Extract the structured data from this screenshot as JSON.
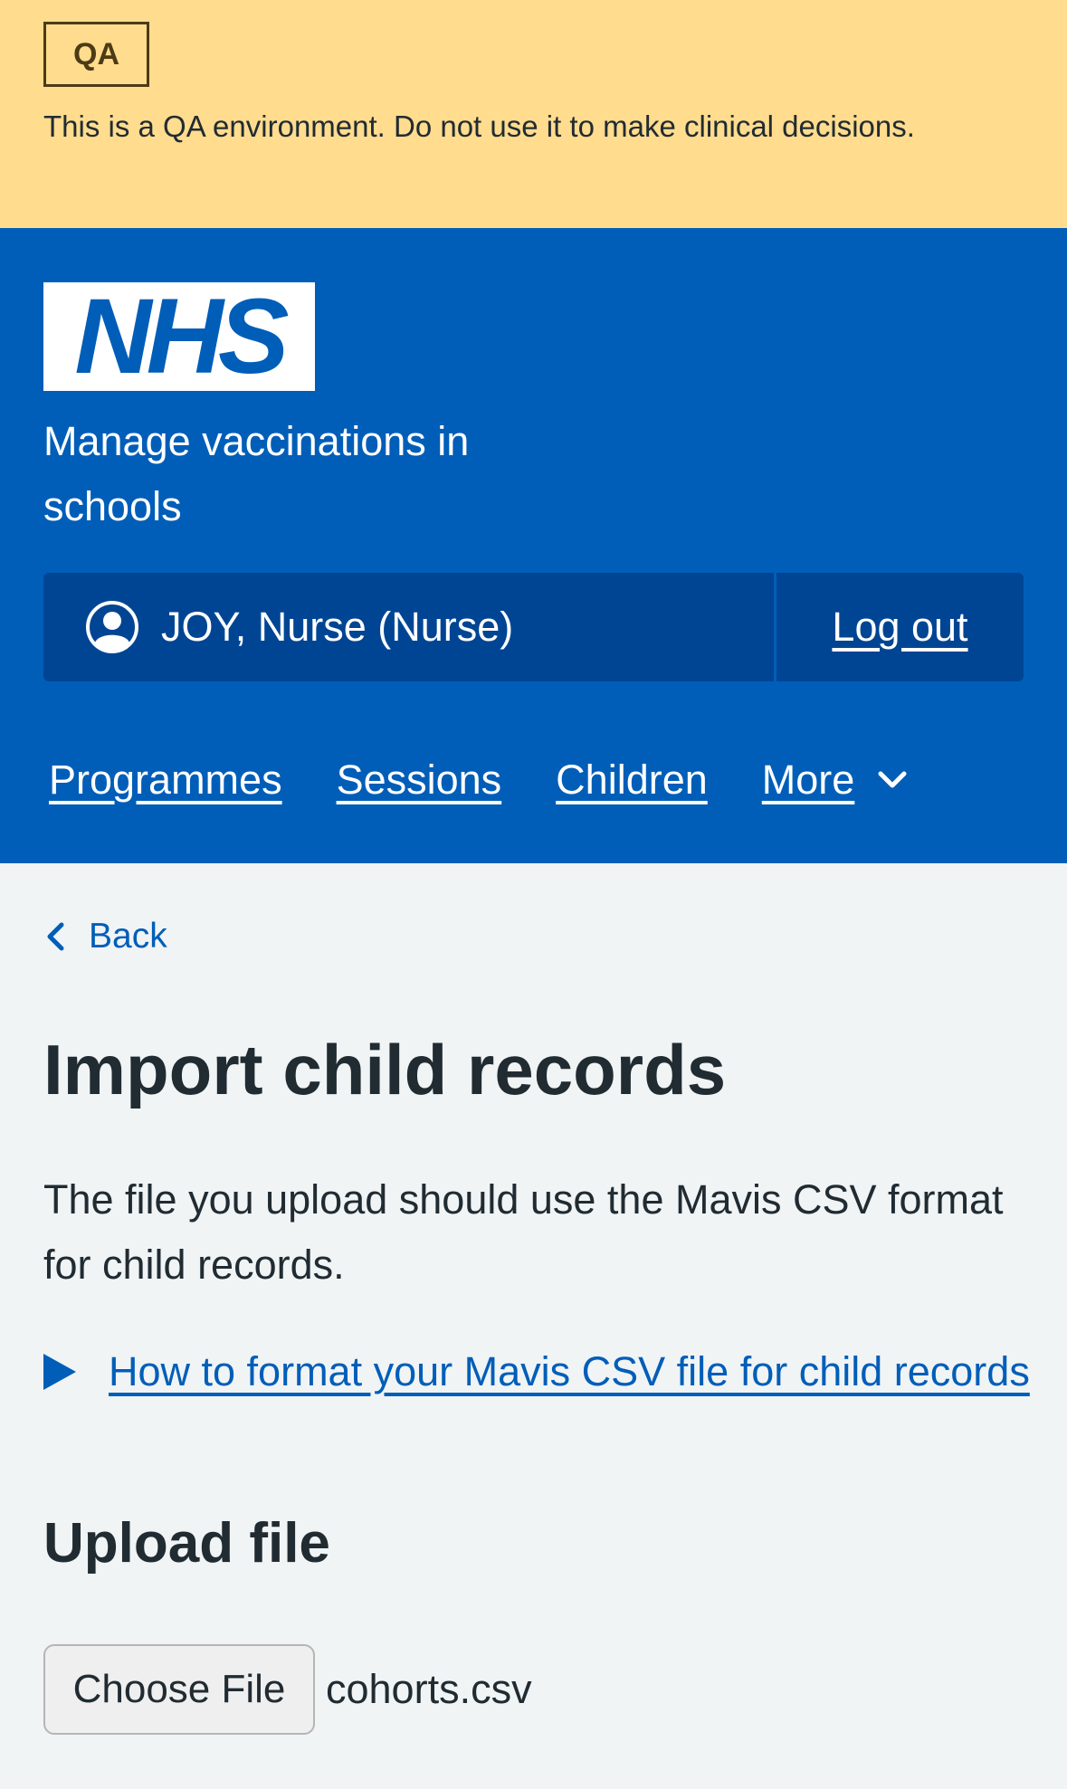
{
  "qa_banner": {
    "tag": "QA",
    "message": "This is a QA environment. Do not use it to make clinical decisions."
  },
  "header": {
    "logo_text": "NHS",
    "service_name": "Manage vaccinations in schools",
    "account": {
      "user": "JOY, Nurse (Nurse)",
      "logout_label": "Log out"
    },
    "nav": [
      {
        "label": "Programmes"
      },
      {
        "label": "Sessions"
      },
      {
        "label": "Children"
      }
    ],
    "nav_more_label": "More"
  },
  "main": {
    "back_label": "Back",
    "title": "Import child records",
    "intro": "The file you upload should use the Mavis CSV format for child records.",
    "details_summary": "How to format your Mavis CSV file for child records",
    "upload_heading": "Upload file",
    "file_input": {
      "button_label": "Choose File",
      "selected_file": "cohorts.csv"
    }
  },
  "colors": {
    "nhs_blue": "#005eb8",
    "account_bg": "#004593",
    "qa_banner_bg": "#ffdc8e",
    "page_bg": "#f0f4f5",
    "text": "#212b32"
  }
}
